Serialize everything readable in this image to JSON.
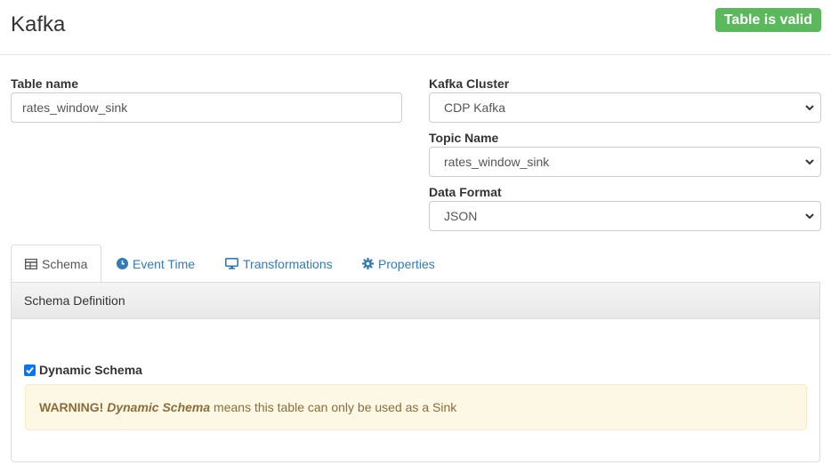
{
  "header": {
    "title": "Kafka",
    "status_badge": "Table is valid"
  },
  "form": {
    "table_name_label": "Table name",
    "table_name_value": "rates_window_sink",
    "kafka_cluster_label": "Kafka Cluster",
    "kafka_cluster_value": "CDP Kafka",
    "topic_name_label": "Topic Name",
    "topic_name_value": "rates_window_sink",
    "data_format_label": "Data Format",
    "data_format_value": "JSON"
  },
  "tabs": [
    {
      "label": "Schema",
      "icon": "table-icon",
      "active": true
    },
    {
      "label": "Event Time",
      "icon": "clock-icon",
      "active": false
    },
    {
      "label": "Transformations",
      "icon": "monitor-icon",
      "active": false
    },
    {
      "label": "Properties",
      "icon": "gear-icon",
      "active": false
    }
  ],
  "schema_panel": {
    "heading": "Schema Definition",
    "dynamic_schema_label": "Dynamic Schema",
    "dynamic_schema_checked": true,
    "warning_prefix": "WARNING!",
    "warning_emphasis": "Dynamic Schema",
    "warning_text": " means this table can only be used as a Sink"
  },
  "colors": {
    "success": "#5cb85c",
    "link": "#337ab7",
    "warning_bg": "#fcf8e3",
    "warning_text": "#8a6d3b"
  }
}
